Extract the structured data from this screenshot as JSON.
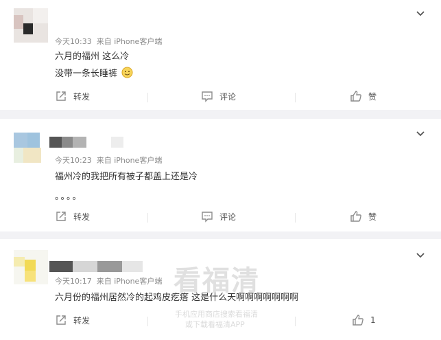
{
  "comments": [
    {
      "time": "今天10:33",
      "source": "来自 iPhone客户端",
      "lines": [
        "六月的福州 这么冷",
        "没带一条长睡裤"
      ],
      "emoji": "smiley-emoji",
      "actions": {
        "repost": "转发",
        "comment": "评论",
        "like": "赞"
      }
    },
    {
      "time": "今天10:23",
      "source": "来自 iPhone客户端",
      "lines": [
        "福州冷的我把所有被子都盖上还是冷",
        "。。。。"
      ],
      "actions": {
        "repost": "转发",
        "comment": "评论",
        "like": "赞"
      }
    },
    {
      "time": "今天10:17",
      "source": "来自 iPhone客户端",
      "lines": [
        "六月份的福州居然冷的起鸡皮疙瘩 这是什么天啊啊啊啊啊啊啊"
      ],
      "actions": {
        "repost": "转发",
        "like_count": "1"
      }
    }
  ],
  "watermark": {
    "brand": "看福清",
    "line1": "手机应用商店搜索看福清",
    "line2": "或下载看福清APP"
  },
  "icons": {
    "menu": "chevron-down-icon",
    "repost": "repost-icon",
    "comment": "comment-icon",
    "like": "thumbs-up-icon"
  },
  "colors": {
    "background": "#f2f2f5",
    "card": "#ffffff",
    "meta_text": "#8a8a8a",
    "icon": "#8c8c8c"
  }
}
